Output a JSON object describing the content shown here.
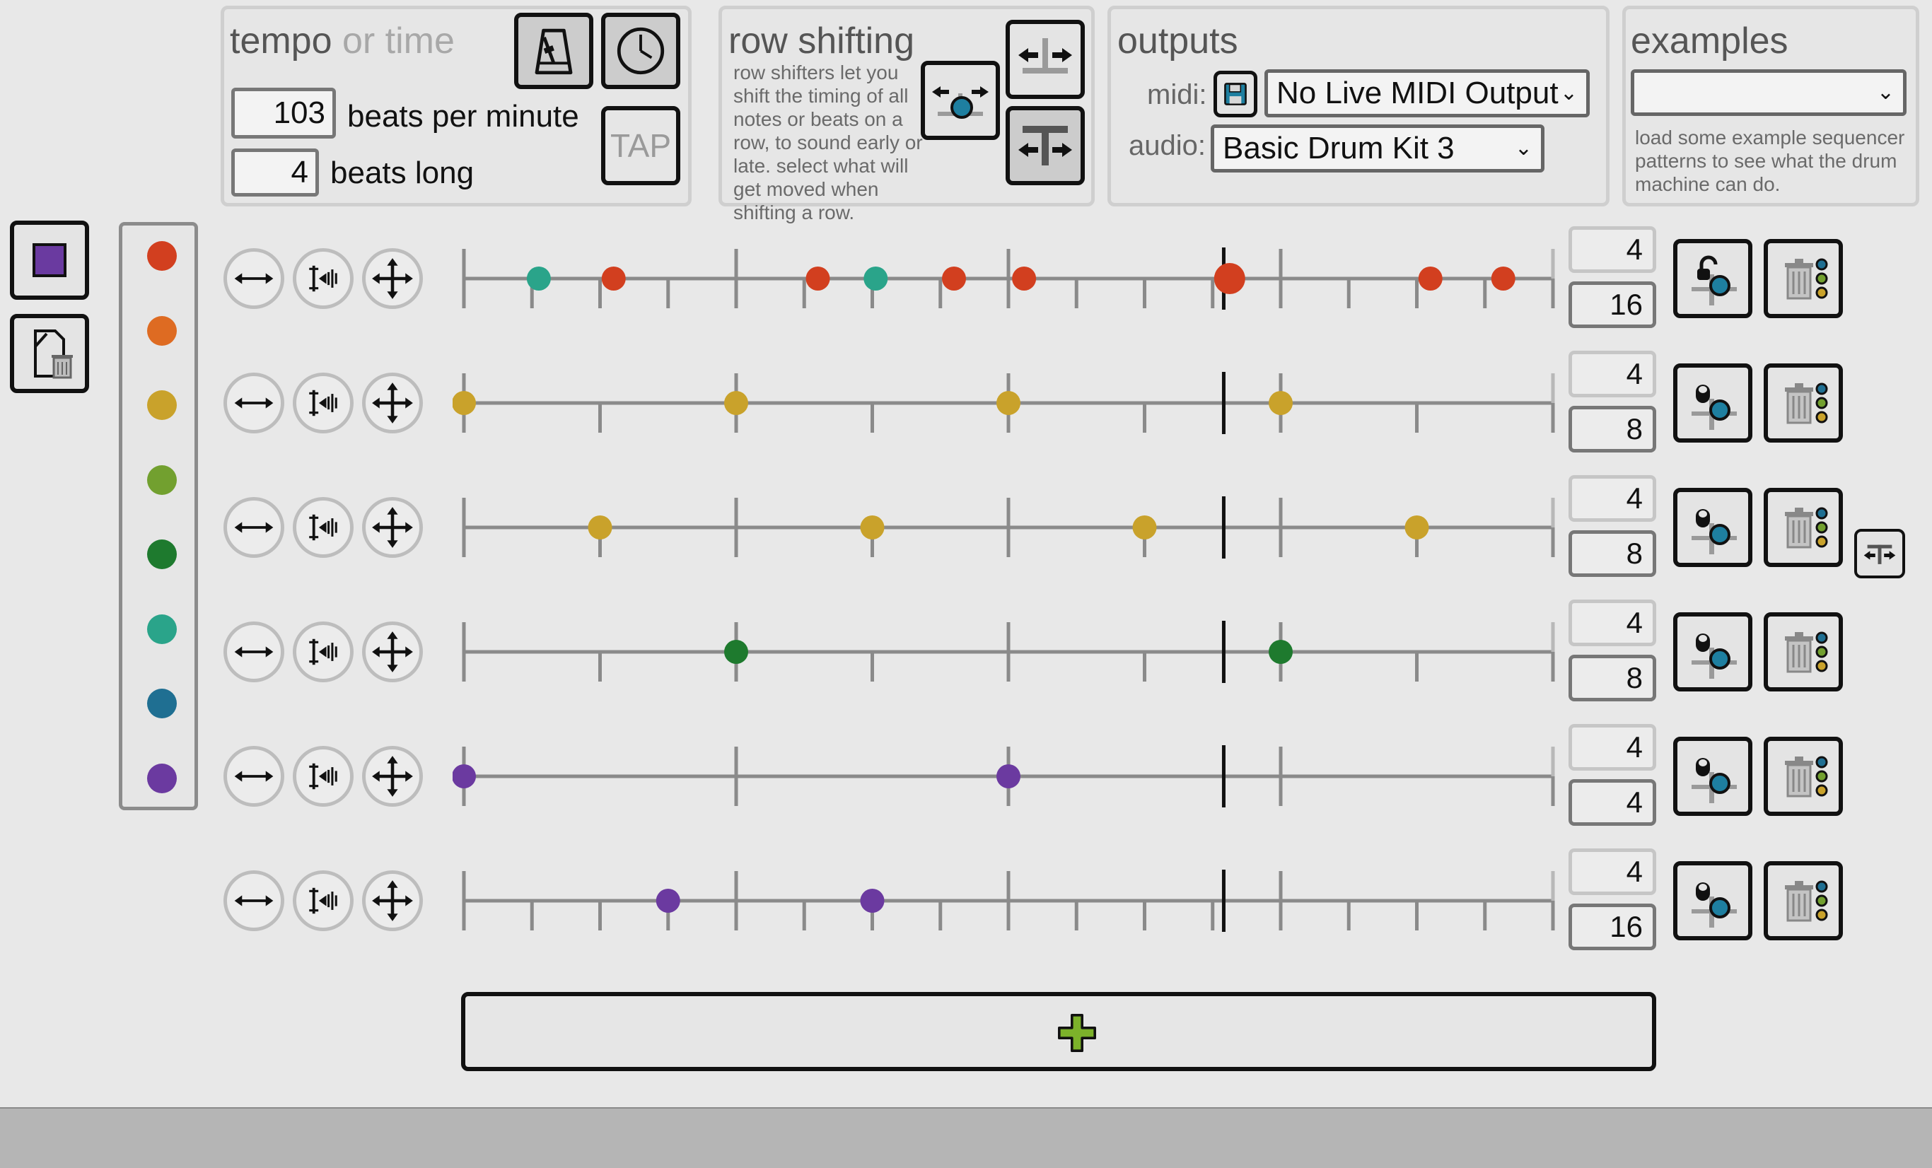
{
  "tempo": {
    "title_main": "tempo",
    "title_dim": "or time",
    "bpm_value": "103",
    "bpm_label": "beats per minute",
    "beats_value": "4",
    "beats_label": "beats long",
    "tap_label": "TAP"
  },
  "shifting": {
    "title": "row shifting",
    "help": "row shifters let you shift the timing of all notes or beats on a row, to sound early or late. select what will get moved when shifting a row."
  },
  "outputs": {
    "title": "outputs",
    "midi_label": "midi:",
    "midi_selected": "No Live MIDI Output",
    "audio_label": "audio:",
    "audio_selected": "Basic Drum Kit 3"
  },
  "examples": {
    "title": "examples",
    "selected": "",
    "help": "load some example sequencer patterns to see what the drum machine can do."
  },
  "colors": {
    "palette": [
      "#d23f1f",
      "#de6b22",
      "#c9a22b",
      "#72a02f",
      "#1e7a2e",
      "#2aa48a",
      "#1f6f92",
      "#6b3aa0"
    ],
    "stop_square": "#6a3aa0",
    "add_plus": "#7cb22a",
    "teal_knob": "#1e7fa0"
  },
  "rows": [
    {
      "beats": "4",
      "subdivisions": "16",
      "notes": [
        {
          "step": 1.1,
          "color": "#2aa48a"
        },
        {
          "step": 2.2,
          "color": "#d23f1f"
        },
        {
          "step": 5.2,
          "color": "#d23f1f"
        },
        {
          "step": 6.05,
          "color": "#2aa48a"
        },
        {
          "step": 7.2,
          "color": "#d23f1f"
        },
        {
          "step": 8.23,
          "color": "#d23f1f"
        },
        {
          "step": 11.25,
          "color": "#d23f1f",
          "active": true
        },
        {
          "step": 14.2,
          "color": "#d23f1f"
        },
        {
          "step": 15.27,
          "color": "#d23f1f"
        }
      ]
    },
    {
      "beats": "4",
      "subdivisions": "8",
      "notes": [
        {
          "step": 0,
          "color": "#c9a22b"
        },
        {
          "step": 2,
          "color": "#c9a22b"
        },
        {
          "step": 4,
          "color": "#c9a22b"
        },
        {
          "step": 6,
          "color": "#c9a22b"
        }
      ]
    },
    {
      "beats": "4",
      "subdivisions": "8",
      "notes": [
        {
          "step": 1,
          "color": "#c9a22b"
        },
        {
          "step": 3,
          "color": "#c9a22b"
        },
        {
          "step": 5,
          "color": "#c9a22b"
        },
        {
          "step": 7,
          "color": "#c9a22b"
        }
      ]
    },
    {
      "beats": "4",
      "subdivisions": "8",
      "notes": [
        {
          "step": 2,
          "color": "#1e7a2e"
        },
        {
          "step": 6,
          "color": "#1e7a2e"
        }
      ]
    },
    {
      "beats": "4",
      "subdivisions": "4",
      "notes": [
        {
          "step": 0,
          "color": "#6b3aa0"
        },
        {
          "step": 2,
          "color": "#6b3aa0"
        }
      ]
    },
    {
      "beats": "4",
      "subdivisions": "16",
      "notes": [
        {
          "step": 3,
          "color": "#6b3aa0"
        },
        {
          "step": 6,
          "color": "#6b3aa0"
        }
      ]
    }
  ],
  "playhead_fraction": 0.6977
}
